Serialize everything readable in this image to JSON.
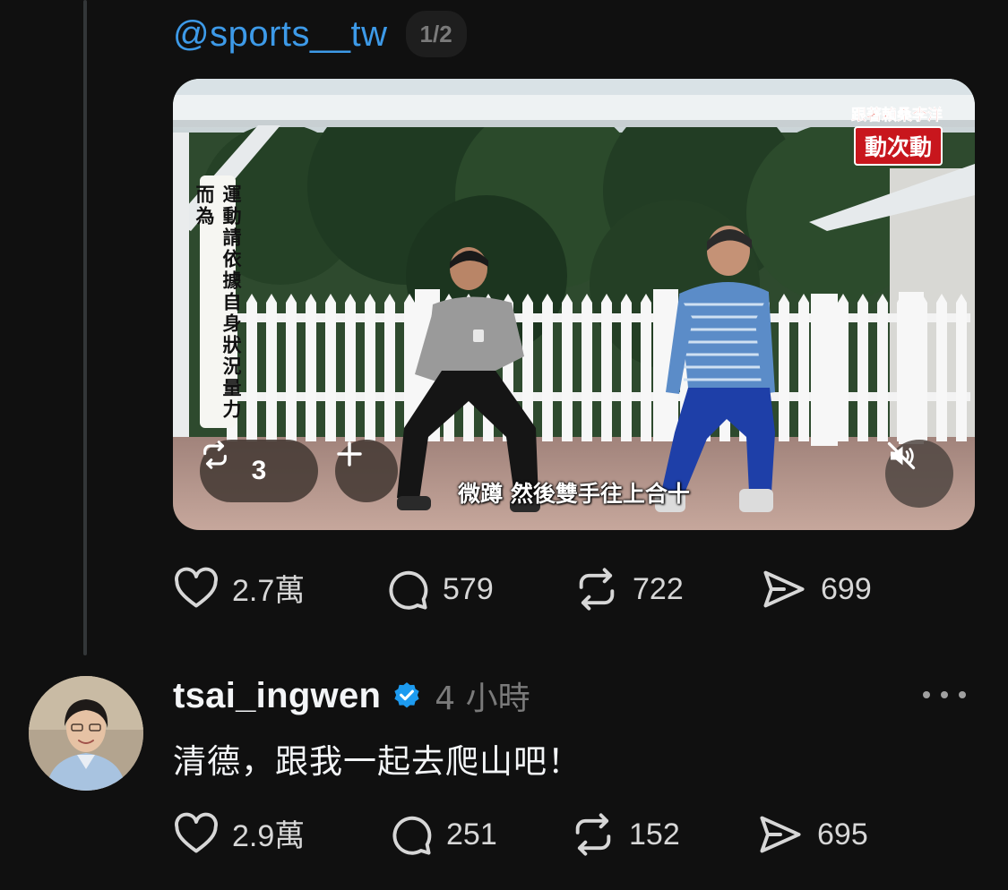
{
  "quoted_post": {
    "mention": "@sports__tw",
    "page_indicator": "1/2",
    "video": {
      "vertical_caption": "運動請依據自身狀況量力而為",
      "logo_line1": "跟著賴桑李洋",
      "logo_line2": "動次動",
      "subtitle": "微蹲 然後雙手往上合十",
      "repost_count": "3",
      "plus_icon": "plus-icon",
      "mute_icon": "muted-speaker-icon"
    },
    "stats": {
      "likes": "2.7萬",
      "replies": "579",
      "reposts": "722",
      "shares": "699"
    }
  },
  "reply_post": {
    "username": "tsai_ingwen",
    "verified": true,
    "time": "4 小時",
    "text": "清德，跟我一起去爬山吧！",
    "stats": {
      "likes": "2.9萬",
      "replies": "251",
      "reposts": "152",
      "shares": "695"
    }
  },
  "colors": {
    "background": "#101010",
    "mention": "#3d9ae8",
    "verified_badge": "#1d9bf0",
    "muted_text": "#7a7a7a"
  }
}
